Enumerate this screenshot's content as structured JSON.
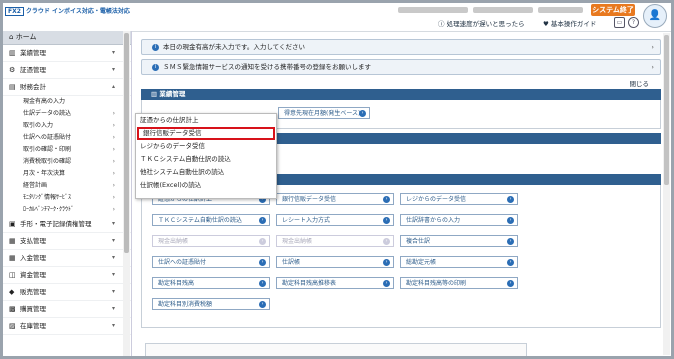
{
  "header": {
    "logo_brand": "FX2",
    "logo_text": "クラウド インボイス対応・電帳法対応",
    "system_end_label": "システム終了",
    "help_link": "処理速度が遅いと思ったら",
    "guide_link": "基本操作ガイド",
    "avatar_glyph": "👤"
  },
  "sidebar": {
    "home_label": "ホーム",
    "items": [
      {
        "label": "業績管理",
        "icon": "chart-icon"
      },
      {
        "label": "証憑管理",
        "icon": "gear-icon"
      },
      {
        "label": "財務会計",
        "icon": "book-icon"
      }
    ],
    "sub_items": [
      {
        "label": "現金有高の入力"
      },
      {
        "label": "仕訳データの読込"
      },
      {
        "label": "取引の入力"
      },
      {
        "label": "仕訳への証憑貼付"
      },
      {
        "label": "取引の確認・印刷"
      },
      {
        "label": "消費税取引の確認"
      },
      {
        "label": "月次・年次決算"
      },
      {
        "label": "経営計画"
      },
      {
        "label": "ﾓﾆﾀﾘﾝｸﾞ情報ｻｰﾋﾞｽ"
      },
      {
        "label": "ﾛｰｶﾙﾍﾞﾝﾁﾏｰｸ･ｸﾗｳﾄﾞ"
      }
    ],
    "lower_items": [
      {
        "label": "手形・電子記録債権管理"
      },
      {
        "label": "支払管理"
      },
      {
        "label": "入金管理"
      },
      {
        "label": "資金管理"
      },
      {
        "label": "販売管理"
      },
      {
        "label": "購買管理"
      },
      {
        "label": "在庫管理"
      }
    ]
  },
  "notices": [
    "本日の現金有高が未入力です。入力してください",
    "ＳＭＳ緊急情報サービスの通知を受ける携帯番号の登録をお願いします"
  ],
  "close_label": "閉じる",
  "panel1": {
    "title": "業績管理",
    "button": "得意先現在月額(発生ベース)"
  },
  "popup": {
    "items": [
      "証憑からの仕訳計上",
      "銀行信販データ受信",
      "レジからのデータ受信",
      "ＴＫＣシステム自動仕訳の読込",
      "他社システム自動仕訳の読込",
      "仕訳帳(Excel)の読込"
    ],
    "highlighted_index": 1
  },
  "panel2": {
    "buttons": [
      {
        "label": "証憑からの仕訳計上",
        "disabled": false
      },
      {
        "label": "銀行信販データ受信",
        "disabled": false
      },
      {
        "label": "レジからのデータ受信",
        "disabled": false
      },
      {
        "label": "ＴＫＣシステム自動仕訳の読込",
        "disabled": false
      },
      {
        "label": "レシート入力方式",
        "disabled": false
      },
      {
        "label": "仕訳辞書からの入力",
        "disabled": false
      },
      {
        "label": "現金出納帳",
        "disabled": true
      },
      {
        "label": "現金出納帳",
        "disabled": true
      },
      {
        "label": "複合仕訳",
        "disabled": false
      },
      {
        "label": "仕訳への証憑貼付",
        "disabled": false
      },
      {
        "label": "仕訳帳",
        "disabled": false
      },
      {
        "label": "総勘定元帳",
        "disabled": false
      },
      {
        "label": "勘定科目残高",
        "disabled": false
      },
      {
        "label": "勘定科目残高推移表",
        "disabled": false
      },
      {
        "label": "勘定科目残高等の印刷",
        "disabled": false
      },
      {
        "label": "勘定科目別消費税額",
        "disabled": false
      }
    ]
  },
  "colors": {
    "accent": "#e8791f",
    "panel_header": "#2f5f8f",
    "highlight_border": "#d7121a"
  }
}
